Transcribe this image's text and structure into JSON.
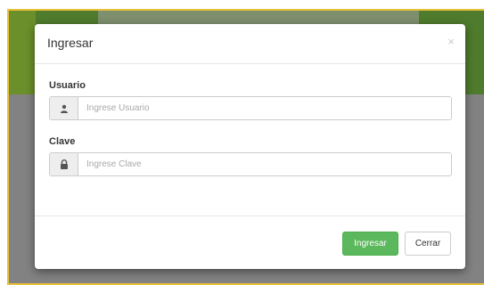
{
  "modal": {
    "title": "Ingresar",
    "close_glyph": "×"
  },
  "usuario": {
    "label": "Usuario",
    "placeholder": "Ingrese Usuario",
    "value": "",
    "icon": "user-icon"
  },
  "clave": {
    "label": "Clave",
    "placeholder": "Ingrese Clave",
    "value": "",
    "icon": "lock-icon"
  },
  "footer": {
    "submit_label": "Ingresar",
    "close_label": "Cerrar"
  },
  "colors": {
    "primary_success": "#5cb85c",
    "backdrop": "#828282",
    "header_green": "#4f7b2c",
    "frame_border": "#e8c13a"
  }
}
